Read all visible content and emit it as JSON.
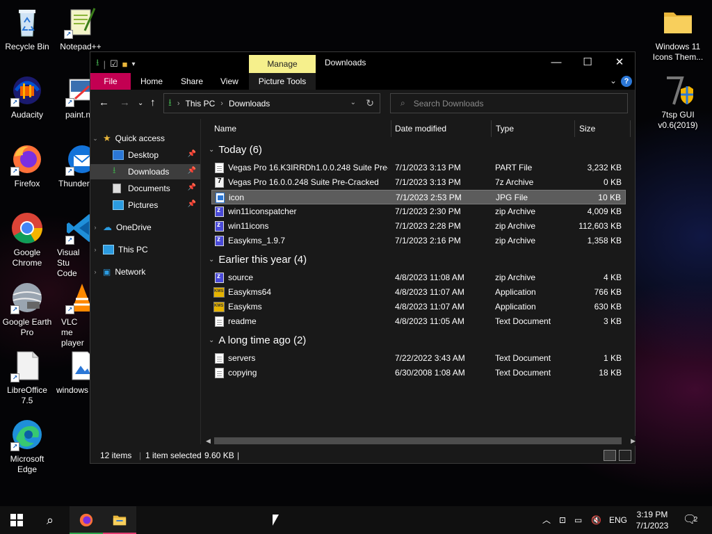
{
  "desktop": {
    "icons": [
      {
        "label": "Recycle Bin"
      },
      {
        "label": "Notepad++"
      },
      {
        "label": "Audacity"
      },
      {
        "label": "paint.n"
      },
      {
        "label": "Firefox"
      },
      {
        "label": "Thunder"
      },
      {
        "label": "Google Chrome"
      },
      {
        "label": "Visual Stu Code"
      },
      {
        "label": "Google Earth Pro"
      },
      {
        "label": "VLC me player"
      },
      {
        "label": "LibreOffice 7.5"
      },
      {
        "label": "windows"
      },
      {
        "label": "Microsoft Edge"
      },
      {
        "label": "Windows 11 Icons Them..."
      },
      {
        "label": "7tsp GUI v0.6(2019)"
      }
    ]
  },
  "window": {
    "title": "Downloads",
    "manage_tab": "Manage",
    "ribbon_tabs": [
      "File",
      "Home",
      "Share",
      "View",
      "Picture Tools"
    ],
    "address": {
      "crumbs": [
        "This PC",
        "Downloads"
      ]
    },
    "search": {
      "placeholder": "Search Downloads"
    },
    "nav": {
      "quick_access": "Quick access",
      "items": [
        "Desktop",
        "Downloads",
        "Documents",
        "Pictures"
      ],
      "onedrive": "OneDrive",
      "this_pc": "This PC",
      "network": "Network"
    },
    "columns": {
      "name": "Name",
      "date": "Date modified",
      "type": "Type",
      "size": "Size"
    },
    "groups": [
      {
        "title": "Today (6)",
        "files": [
          {
            "name": "Vegas Pro 16.K3IRRDh1.0.0.248 Suite Pre-...",
            "date": "7/1/2023 3:13 PM",
            "type": "PART File",
            "size": "3,232 KB",
            "icon": "document-icon"
          },
          {
            "name": "Vegas Pro 16.0.0.248 Suite Pre-Cracked",
            "date": "7/1/2023 3:13 PM",
            "type": "7z Archive",
            "size": "0 KB",
            "icon": "7z-archive-icon"
          },
          {
            "name": "icon",
            "date": "7/1/2023 2:53 PM",
            "type": "JPG File",
            "size": "10 KB",
            "icon": "jpg-file-icon"
          },
          {
            "name": "win11iconspatcher",
            "date": "7/1/2023 2:30 PM",
            "type": "zip Archive",
            "size": "4,009 KB",
            "icon": "zip-archive-icon"
          },
          {
            "name": "win11icons",
            "date": "7/1/2023 2:28 PM",
            "type": "zip Archive",
            "size": "112,603 KB",
            "icon": "zip-archive-icon"
          },
          {
            "name": "Easykms_1.9.7",
            "date": "7/1/2023 2:16 PM",
            "type": "zip Archive",
            "size": "1,358 KB",
            "icon": "zip-archive-icon"
          }
        ]
      },
      {
        "title": "Earlier this year (4)",
        "files": [
          {
            "name": "source",
            "date": "4/8/2023 11:08 AM",
            "type": "zip Archive",
            "size": "4 KB",
            "icon": "zip-archive-icon"
          },
          {
            "name": "Easykms64",
            "date": "4/8/2023 11:07 AM",
            "type": "Application",
            "size": "766 KB",
            "icon": "kms-application-icon"
          },
          {
            "name": "Easykms",
            "date": "4/8/2023 11:07 AM",
            "type": "Application",
            "size": "630 KB",
            "icon": "kms-application-icon"
          },
          {
            "name": "readme",
            "date": "4/8/2023 11:05 AM",
            "type": "Text Document",
            "size": "3 KB",
            "icon": "document-icon"
          }
        ]
      },
      {
        "title": "A long time ago (2)",
        "files": [
          {
            "name": "servers",
            "date": "7/22/2022 3:43 AM",
            "type": "Text Document",
            "size": "1 KB",
            "icon": "document-icon"
          },
          {
            "name": "copying",
            "date": "6/30/2008 1:08 AM",
            "type": "Text Document",
            "size": "18 KB",
            "icon": "document-icon"
          }
        ]
      }
    ],
    "selected_file": "icon",
    "status": {
      "items": "12 items",
      "selection": "1 item selected",
      "selection_size": "9.60 KB"
    }
  },
  "taskbar": {
    "tray_lang": "ENG",
    "time": "3:19 PM",
    "date": "7/1/2023",
    "notification_count": "2"
  },
  "colors": {
    "file_tab": "#c30052",
    "manage_tab": "#f6f08c",
    "selection": "#5c5c5c",
    "taskbar_active": "#5bc0f8"
  }
}
